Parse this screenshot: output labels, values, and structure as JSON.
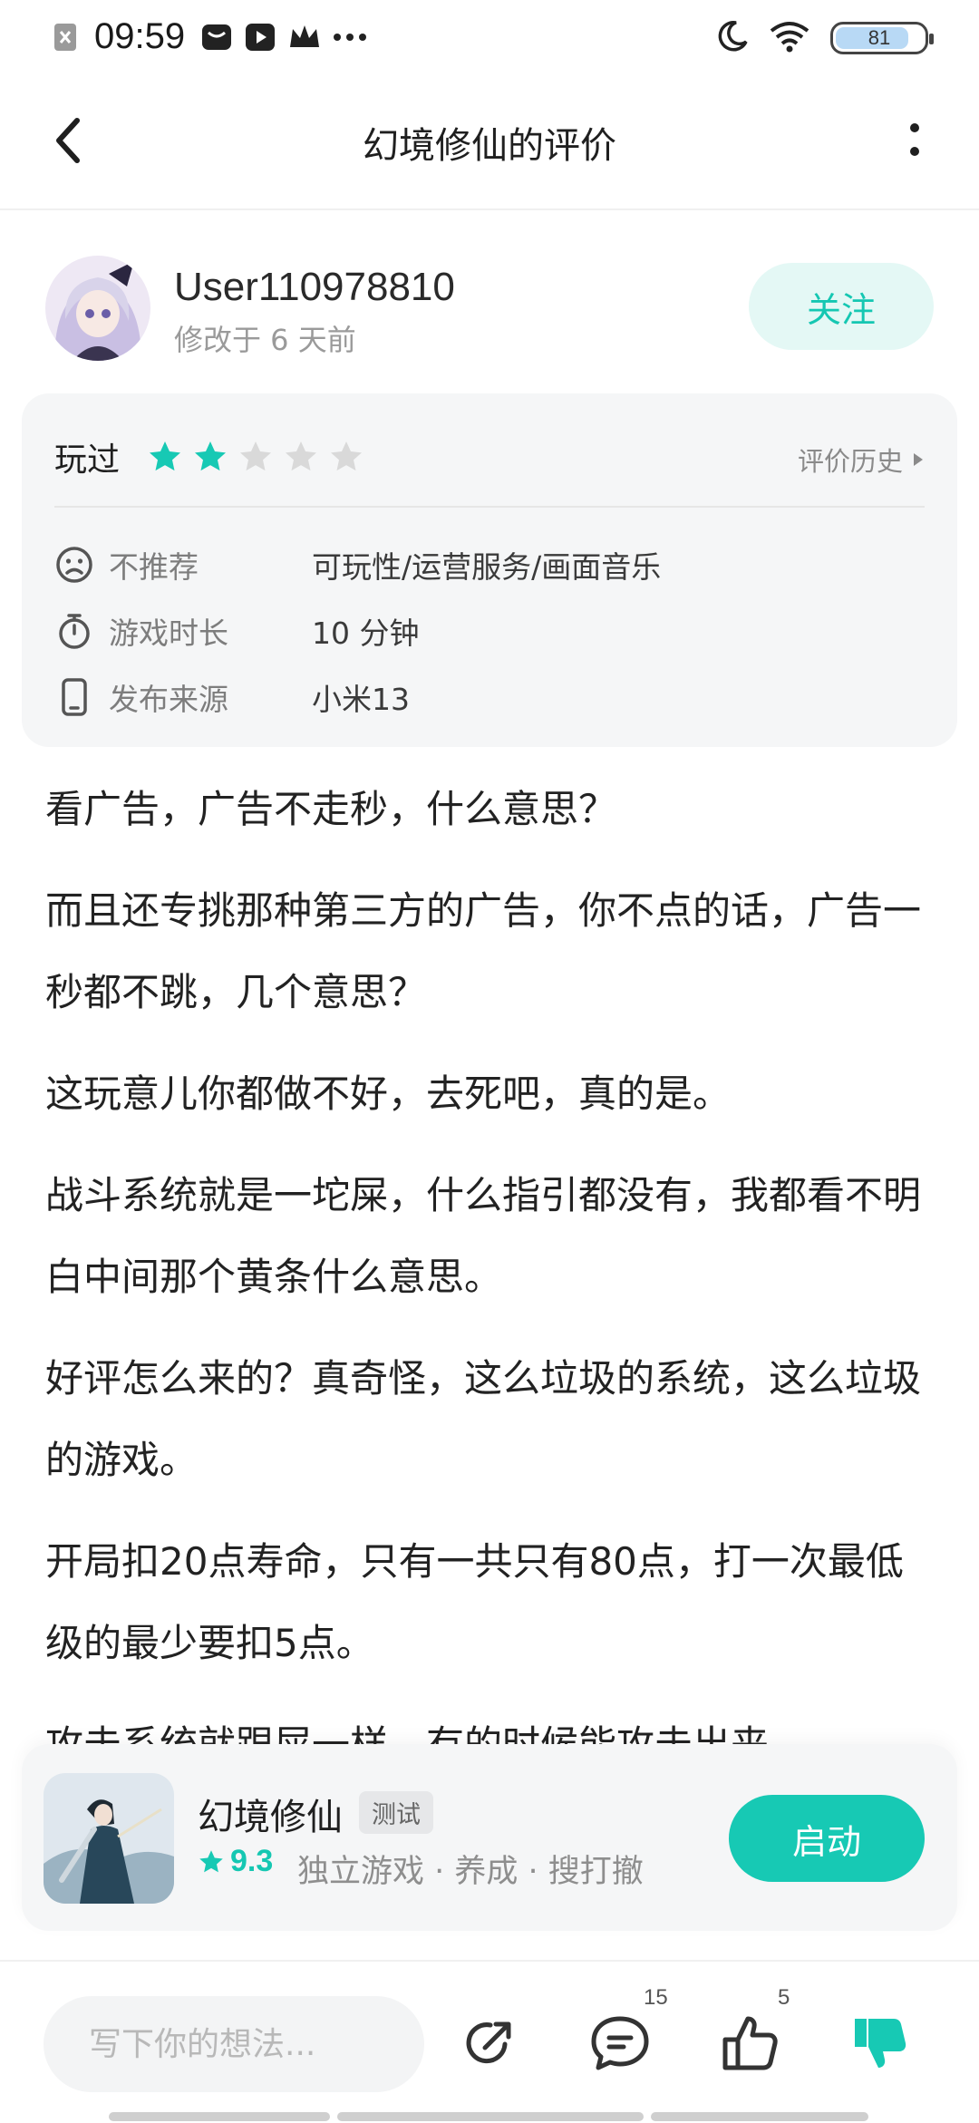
{
  "status_bar": {
    "time": "09:59",
    "battery_level": "81",
    "left_icons": [
      "close-notification-icon",
      "message-icon",
      "video-icon",
      "crown-icon",
      "more-dots-icon"
    ],
    "right_icons": [
      "moon-icon",
      "wifi-icon",
      "battery-icon"
    ]
  },
  "header": {
    "title": "幻境修仙的评价",
    "back_icon": "chevron-left-icon",
    "more_icon": "vertical-dots-icon"
  },
  "author": {
    "name": "User110978810",
    "meta": "修改于 6 天前",
    "follow_label": "关注"
  },
  "rating_card": {
    "status": "玩过",
    "rating": 2,
    "max_rating": 5,
    "history_label": "评价历史",
    "rows": [
      {
        "icon": "sad-face-icon",
        "label": "不推荐",
        "value": "可玩性/运营服务/画面音乐"
      },
      {
        "icon": "stopwatch-icon",
        "label": "游戏时长",
        "value": "10 分钟"
      },
      {
        "icon": "phone-icon",
        "label": "发布来源",
        "value": "小米13"
      }
    ]
  },
  "review": {
    "paragraphs": [
      "看广告，广告不走秒，什么意思？",
      "而且还专挑那种第三方的广告，你不点的话，广告一秒都不跳，几个意思？",
      "这玩意儿你都做不好，去死吧，真的是。",
      "战斗系统就是一坨屎，什么指引都没有，我都看不明白中间那个黄条什么意思。",
      "好评怎么来的？真奇怪，这么垃圾的系统，这么垃圾的游戏。",
      "开局扣20点寿命，只有一共只有80点，打一次最低级的最少要扣5点。",
      "攻击系统就跟屎一样，有的时候能攻击出来"
    ]
  },
  "game": {
    "name": "幻境修仙",
    "tag": "测试",
    "score": "9.3",
    "genres": "独立游戏 · 养成 · 搜打撤",
    "launch_label": "启动"
  },
  "bottom_bar": {
    "input_placeholder": "写下你的想法...",
    "comment_count": "15",
    "like_count": "5"
  },
  "colors": {
    "accent": "#17c9b4",
    "accent_light": "#e4f8f5",
    "star_off": "#d9d9d9",
    "card_bg": "#f5f6f7"
  }
}
